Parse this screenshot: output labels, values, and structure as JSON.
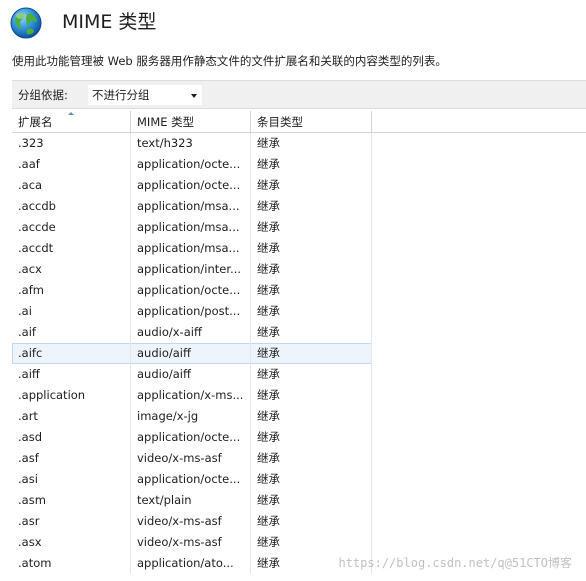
{
  "header": {
    "title": "MIME 类型",
    "description": "使用此功能管理被 Web 服务器用作静态文件的文件扩展名和关联的内容类型的列表。"
  },
  "group_by": {
    "label": "分组依据:",
    "selected": "不进行分组"
  },
  "table": {
    "columns": [
      "扩展名",
      "MIME 类型",
      "条目类型"
    ],
    "sorted_column": "扩展名",
    "sort_direction": "ascending",
    "selected_row": ".aifc",
    "rows": [
      {
        "ext": ".323",
        "mime": "text/h323",
        "type": "继承"
      },
      {
        "ext": ".aaf",
        "mime": "application/octe...",
        "type": "继承"
      },
      {
        "ext": ".aca",
        "mime": "application/octe...",
        "type": "继承"
      },
      {
        "ext": ".accdb",
        "mime": "application/msa...",
        "type": "继承"
      },
      {
        "ext": ".accde",
        "mime": "application/msa...",
        "type": "继承"
      },
      {
        "ext": ".accdt",
        "mime": "application/msa...",
        "type": "继承"
      },
      {
        "ext": ".acx",
        "mime": "application/inter...",
        "type": "继承"
      },
      {
        "ext": ".afm",
        "mime": "application/octe...",
        "type": "继承"
      },
      {
        "ext": ".ai",
        "mime": "application/post...",
        "type": "继承"
      },
      {
        "ext": ".aif",
        "mime": "audio/x-aiff",
        "type": "继承"
      },
      {
        "ext": ".aifc",
        "mime": "audio/aiff",
        "type": "继承"
      },
      {
        "ext": ".aiff",
        "mime": "audio/aiff",
        "type": "继承"
      },
      {
        "ext": ".application",
        "mime": "application/x-ms...",
        "type": "继承"
      },
      {
        "ext": ".art",
        "mime": "image/x-jg",
        "type": "继承"
      },
      {
        "ext": ".asd",
        "mime": "application/octe...",
        "type": "继承"
      },
      {
        "ext": ".asf",
        "mime": "video/x-ms-asf",
        "type": "继承"
      },
      {
        "ext": ".asi",
        "mime": "application/octe...",
        "type": "继承"
      },
      {
        "ext": ".asm",
        "mime": "text/plain",
        "type": "继承"
      },
      {
        "ext": ".asr",
        "mime": "video/x-ms-asf",
        "type": "继承"
      },
      {
        "ext": ".asx",
        "mime": "video/x-ms-asf",
        "type": "继承"
      },
      {
        "ext": ".atom",
        "mime": "application/ato...",
        "type": "继承"
      }
    ]
  },
  "watermark": "https://blog.csdn.net/q@51CTO博客",
  "icons": {
    "header": "globe-icon",
    "dropdown": "chevron-down-icon",
    "sort": "sort-ascending-icon"
  },
  "colors": {
    "selected_row_bg": "#edf4fc",
    "selected_row_border": "#c4d9f1",
    "group_bar_bg": "#f0f0f0"
  }
}
